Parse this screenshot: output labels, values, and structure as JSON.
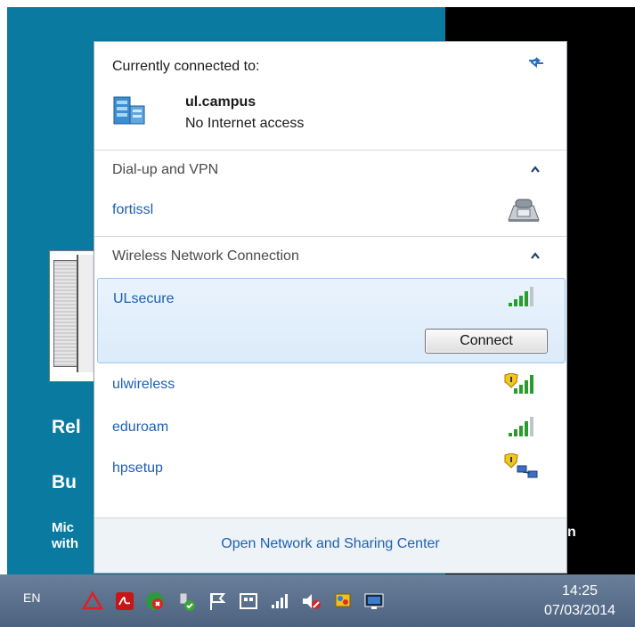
{
  "flyout": {
    "connected_header": "Currently connected to:",
    "current_network": {
      "name": "ul.campus",
      "status": "No Internet access"
    },
    "dialup_section": {
      "title": "Dial-up and VPN",
      "items": [
        {
          "name": "fortissl",
          "icon": "modem-icon"
        }
      ]
    },
    "wireless_section": {
      "title": "Wireless Network Connection",
      "items": [
        {
          "name": "ULsecure",
          "icon": "signal-bars-icon",
          "selected": true,
          "action_label": "Connect"
        },
        {
          "name": "ulwireless",
          "icon": "signal-shield-icon"
        },
        {
          "name": "eduroam",
          "icon": "signal-bars-icon"
        },
        {
          "name": "hpsetup",
          "icon": "adhoc-shield-icon"
        }
      ]
    },
    "footer_link": "Open Network and Sharing Center"
  },
  "background": {
    "text_rel": "Rel",
    "text_bu": "Bu",
    "text_mic_line1": "Mic",
    "text_mic_line2": "with",
    "text_n": "n"
  },
  "taskbar": {
    "language": "EN",
    "clock_time": "14:25",
    "clock_date": "07/03/2014",
    "tray_icons": [
      "warning-triangle-icon",
      "acrobat-icon",
      "sync-icon",
      "usb-device-icon",
      "flag-icon",
      "keyboard-icon",
      "signal-icon",
      "volume-muted-icon",
      "paint-icon",
      "monitor-icon"
    ]
  },
  "colors": {
    "desktop": "#0a7aa1",
    "link": "#1e5fb4",
    "selection": "#dcebfa",
    "taskbar": "#5a6f8c"
  }
}
